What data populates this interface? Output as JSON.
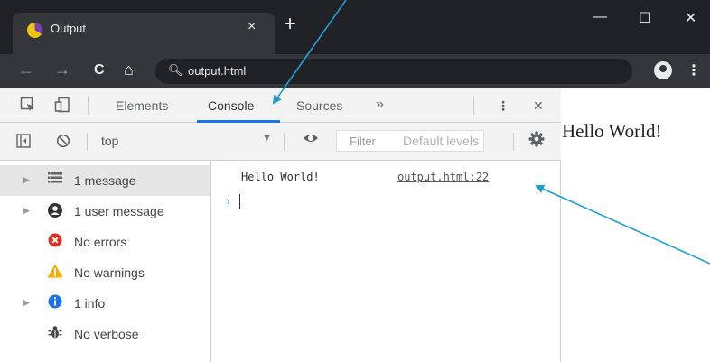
{
  "browser": {
    "tab_title": "Output",
    "tab_close": "×",
    "new_tab": "+",
    "window_controls": {
      "minimize": "—",
      "maximize": "☐",
      "close": "✕"
    },
    "nav": {
      "back": "←",
      "forward": "→",
      "reload": "C",
      "home": "⌂"
    },
    "search_icon": "🔍︎",
    "url": "output.html",
    "menu": "⋮"
  },
  "devtools": {
    "tabs": [
      {
        "label": "Elements"
      },
      {
        "label": "Console"
      },
      {
        "label": "Sources"
      }
    ],
    "more_tabs": "»",
    "menu": "⋮",
    "close": "✕",
    "context": "top",
    "filter_placeholder": "Filter",
    "levels": "Default levels",
    "sidebar": [
      {
        "label": "1 message",
        "icon": "list-icon"
      },
      {
        "label": "1 user message",
        "icon": "user-icon"
      },
      {
        "label": "No errors",
        "icon": "error-icon"
      },
      {
        "label": "No warnings",
        "icon": "warning-icon"
      },
      {
        "label": "1 info",
        "icon": "info-icon"
      },
      {
        "label": "No verbose",
        "icon": "bug-icon"
      }
    ],
    "console": {
      "message": "Hello World!",
      "source": "output.html:22",
      "prompt": "›"
    }
  },
  "page": {
    "text": "Hello World!"
  },
  "colors": {
    "tab_underline": "#1a73e8",
    "annotation_arrow": "#1f9fd6",
    "error": "#d93025",
    "warning": "#f9ab00",
    "info": "#1a73e8"
  }
}
